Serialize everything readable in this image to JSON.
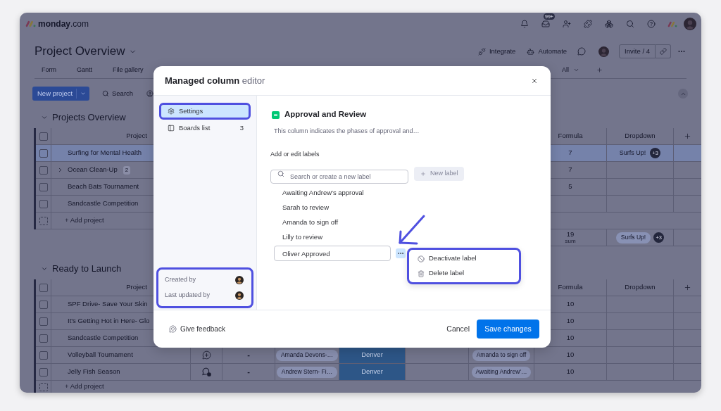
{
  "app": {
    "logo": "**monday**.com",
    "inbox_badge": "99+"
  },
  "board": {
    "title": "Project Overview",
    "actions": [
      {
        "kind": "integrate",
        "label": "Integrate"
      },
      {
        "kind": "automate",
        "label": "Automate"
      }
    ],
    "invite": "Invite / 4",
    "views": [
      {
        "label": "Form"
      },
      {
        "label": "Gantt"
      },
      {
        "label": "File gallery"
      }
    ],
    "view_filter": "All"
  },
  "toolbar": {
    "primary_button": "New project",
    "search": "Search"
  },
  "groups": [
    {
      "title": "Projects Overview",
      "all_checked": false,
      "columns": {
        "name": "Project",
        "formula": "Formula",
        "dropdown": "Dropdown"
      },
      "rows": [
        {
          "name": "Surfing for Mental Health",
          "checked": false,
          "selected": true,
          "formula": "7",
          "dropdown": "Surfs Up!",
          "dropdown_more": "+3"
        },
        {
          "name": "Ocean Clean-Up",
          "checked": false,
          "selected": false,
          "subitems": "2",
          "formula": "7"
        },
        {
          "name": "Beach Bats Tournament",
          "checked": false,
          "selected": false,
          "formula": "5"
        },
        {
          "name": "Sandcastle Competition",
          "checked": false,
          "selected": false
        }
      ],
      "add_row": "+ Add project",
      "summary": {
        "formula": "19",
        "formula_caption": "sum",
        "dropdown": "Surfs Up!",
        "dropdown_more": "+3"
      }
    },
    {
      "title": "Ready to Launch",
      "all_checked": false,
      "columns": {
        "name": "Project",
        "formula": "Formula",
        "dropdown": "Dropdown"
      },
      "rows": [
        {
          "name": "SPF Drive- Save Your Skin",
          "checked": false,
          "selected": false,
          "formula": "10"
        },
        {
          "name": "It's Getting Hot in Here- Glo",
          "checked": false,
          "selected": false,
          "formula": "10"
        },
        {
          "name": "Sandcastle Competition",
          "checked": false,
          "selected": false,
          "formula": "10"
        },
        {
          "name": "Volleyball Tournament",
          "checked": false,
          "selected": false,
          "updates": {
            "kind": "add"
          },
          "column_3": "-",
          "column_4": "Amanda Devons-…",
          "column_5": "Denver",
          "column_7": "Amanda to sign off",
          "formula": "10"
        },
        {
          "name": "Jelly Fish Season",
          "checked": false,
          "selected": false,
          "updates": {
            "kind": "unread"
          },
          "column_3": "-",
          "column_4": "Andrew Stern- Fi…",
          "column_5": "Denver",
          "column_7": "Awaiting Andrew'…",
          "formula": "10"
        }
      ],
      "add_row": "+ Add project"
    }
  ],
  "modal": {
    "title": "**Managed column** editor",
    "sidebar": {
      "items": [
        {
          "kind": "settings",
          "label": "Settings",
          "selected": true,
          "highlighted": true
        },
        {
          "kind": "boards",
          "label": "Boards list",
          "count": "3",
          "selected": false,
          "highlighted": false
        }
      ],
      "meta": {
        "highlighted": true,
        "rows": [
          {
            "label": "Created by"
          },
          {
            "label": "Last updated by"
          }
        ]
      }
    },
    "column": {
      "title": "Approval and Review",
      "description": "This column indicates the phases of approval and…"
    },
    "labels_heading": "Add or edit labels",
    "search": {
      "placeholder": "Search or create a new label"
    },
    "new_label": {
      "label": "New label",
      "disabled": true
    },
    "labels": [
      {
        "text": "Awaiting Andrew's approval",
        "editing": false
      },
      {
        "text": "Sarah to review",
        "editing": false
      },
      {
        "text": "Amanda to sign off",
        "editing": false
      },
      {
        "text": "Lilly to review",
        "editing": false
      },
      {
        "text": "Oliver Approved",
        "editing": true
      }
    ],
    "label_menu": {
      "highlighted": true,
      "items": [
        {
          "kind": "deactivate",
          "label": "Deactivate label"
        },
        {
          "kind": "delete",
          "label": "Delete label"
        }
      ]
    },
    "footer": {
      "feedback": "Give feedback",
      "cancel": "Cancel",
      "save": "Save changes"
    }
  }
}
